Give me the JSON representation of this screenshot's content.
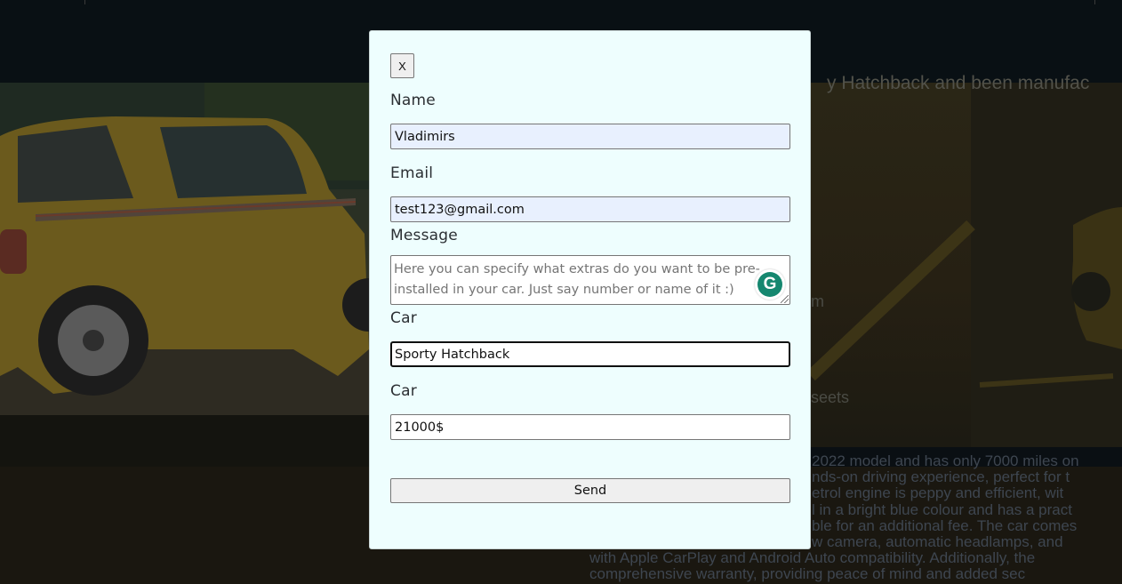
{
  "background": {
    "hero_title_fragment": "y Hatchback and been manufac",
    "spec_fragment_1": "m",
    "spec_fragment_2": "seets",
    "description_lines": [
      "2022 model and has only 7000 miles on",
      "nds-on driving experience, perfect for t",
      "etrol engine is peppy and efficient, wit",
      "l in a bright blue colour and has a pract",
      "ble for an additional fee. The car comes",
      "w camera, automatic headlamps, and",
      "with Apple CarPlay and Android Auto compatibility. Additionally, the",
      "comprehensive warranty, providing peace of mind and added sec"
    ]
  },
  "modal": {
    "close_label": "X",
    "name_label": "Name",
    "name_value": "Vladimirs",
    "email_label": "Email",
    "email_value": "test123@gmail.com",
    "message_label": "Message",
    "message_placeholder": "Here you can specify what extras do you want to be pre-installed in your car. Just say number or name of it :)",
    "car_label": "Car",
    "car_value": "Sporty Hatchback",
    "price_label": "Car",
    "price_value": "21000$",
    "send_label": "Send",
    "grammarly_letter": "G"
  },
  "colors": {
    "modal_bg": "#eefefe",
    "autofill_bg": "#e8f0fe",
    "grammarly_green": "#15876f"
  }
}
